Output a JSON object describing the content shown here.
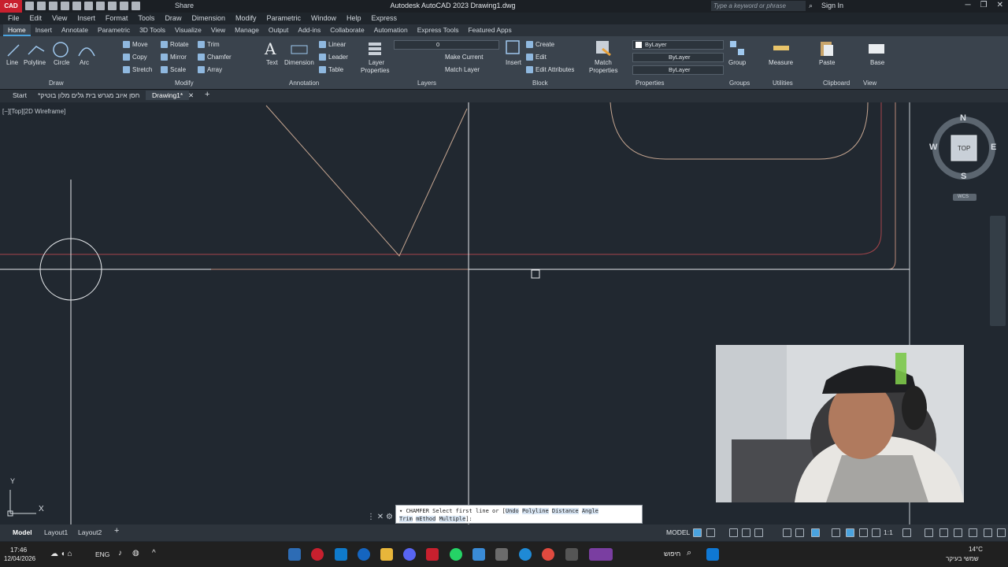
{
  "titlebar": {
    "logo": "CAD",
    "share": "Share",
    "title": "Autodesk AutoCAD 2023   Drawing1.dwg",
    "search_placeholder": "Type a keyword or phrase",
    "signin": "Sign In"
  },
  "menubar": [
    "File",
    "Edit",
    "View",
    "Insert",
    "Format",
    "Tools",
    "Draw",
    "Dimension",
    "Modify",
    "Parametric",
    "Window",
    "Help",
    "Express"
  ],
  "ribbon_tabs": [
    "Home",
    "Insert",
    "Annotate",
    "Parametric",
    "3D Tools",
    "Visualize",
    "View",
    "Manage",
    "Output",
    "Add-ins",
    "Collaborate",
    "Automation",
    "Express Tools",
    "Featured Apps"
  ],
  "ribbon": {
    "draw": {
      "line": "Line",
      "polyline": "Polyline",
      "circle": "Circle",
      "arc": "Arc",
      "title": "Draw"
    },
    "modify": {
      "move": "Move",
      "rotate": "Rotate",
      "trim": "Trim",
      "copy": "Copy",
      "mirror": "Mirror",
      "chamfer": "Chamfer",
      "stretch": "Stretch",
      "scale": "Scale",
      "array": "Array",
      "title": "Modify"
    },
    "annotation": {
      "text": "Text",
      "dimension": "Dimension",
      "linear": "Linear",
      "leader": "Leader",
      "table": "Table",
      "title": "Annotation"
    },
    "layers": {
      "layer_properties_1": "Layer",
      "layer_properties_2": "Properties",
      "layer_value": "0",
      "make_current": "Make Current",
      "match_layer": "Match Layer",
      "title": "Layers"
    },
    "block": {
      "insert": "Insert",
      "create": "Create",
      "edit": "Edit",
      "edit_attributes": "Edit Attributes",
      "title": "Block"
    },
    "properties": {
      "match_1": "Match",
      "match_2": "Properties",
      "color": "ByLayer",
      "linetype": "ByLayer",
      "lineweight": "ByLayer",
      "title": "Properties"
    },
    "groups": {
      "group": "Group",
      "title": "Groups"
    },
    "utilities": {
      "measure": "Measure",
      "title": "Utilities"
    },
    "clipboard": {
      "paste": "Paste",
      "title": "Clipboard"
    },
    "view": {
      "base": "Base",
      "title": "View"
    }
  },
  "doc_tabs": {
    "start": "Start",
    "file1": "חסן איוב מגרש בית גלים מלון בוטיק*",
    "file2": "Drawing1*"
  },
  "viewport_label": "[−][Top][2D Wireframe]",
  "viewcube": {
    "n": "N",
    "s": "S",
    "e": "E",
    "w": "W",
    "top": "TOP",
    "wcs": "WCS"
  },
  "ucs": {
    "x": "X",
    "y": "Y"
  },
  "command": {
    "prefix": "CHAMFER Select first line or [",
    "opt_undo": "Undo",
    "opt_polyline": "Polyline",
    "opt_distance": "Distance",
    "opt_angle": "Angle",
    "line2_a": "Trim",
    "line2_b": "mEthod",
    "line2_c": "Multiple",
    "suffix": "]:"
  },
  "layout_tabs": {
    "model": "Model",
    "layout1": "Layout1",
    "layout2": "Layout2"
  },
  "status": {
    "model": "MODEL",
    "scale": "1:1"
  },
  "taskbar": {
    "time": "17:46",
    "date": "12/04/2026",
    "lang": "ENG",
    "search": "חיפוש",
    "weather_temp": "14°C",
    "weather_desc": "שמשי בעיקר"
  },
  "colors": {
    "accent": "#4aa3df",
    "canvas": "#212830",
    "ribbon": "#3a434d",
    "red_line": "#a6454b",
    "peach_line": "#b98978",
    "tan_line": "#c6a691"
  }
}
